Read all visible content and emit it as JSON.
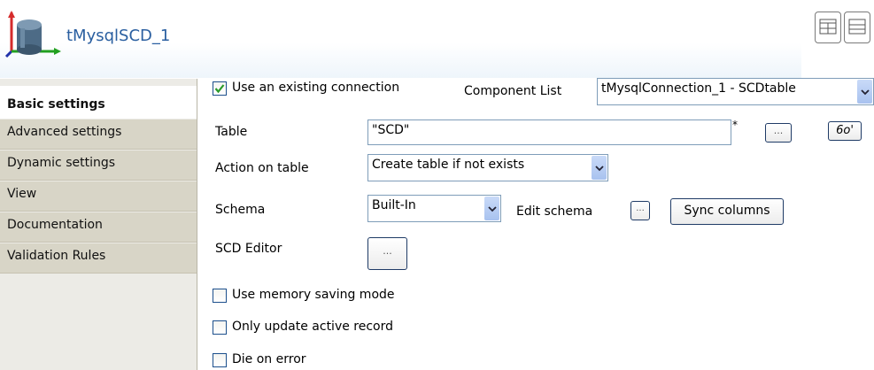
{
  "component": {
    "title": "tMysqlSCD_1",
    "icon": "database-cylinder-icon"
  },
  "header_buttons": [
    "grid-layout-icon",
    "list-layout-icon"
  ],
  "sidebar": {
    "items": [
      {
        "label": "Basic settings",
        "active": true
      },
      {
        "label": "Advanced settings",
        "active": false
      },
      {
        "label": "Dynamic settings",
        "active": false
      },
      {
        "label": "View",
        "active": false
      },
      {
        "label": "Documentation",
        "active": false
      },
      {
        "label": "Validation Rules",
        "active": false
      }
    ]
  },
  "form": {
    "use_existing": {
      "label": "Use an existing connection",
      "checked": true
    },
    "component_list": {
      "label": "Component List",
      "value": "tMysqlConnection_1 - SCDtable"
    },
    "table": {
      "label": "Table",
      "value": "\"SCD\"",
      "required_mark": "*",
      "browse": "...",
      "view_icon": "glasses-icon",
      "view_text": "6o'"
    },
    "action_on_table": {
      "label": "Action on table",
      "value": "Create table if not exists"
    },
    "schema": {
      "label": "Schema",
      "value": "Built-In",
      "edit_label": "Edit schema",
      "edit_button": "...",
      "sync_button": "Sync columns"
    },
    "scd_editor": {
      "label": "SCD Editor",
      "button": "..."
    },
    "memory_saving": {
      "label": "Use memory saving mode",
      "checked": false
    },
    "update_active": {
      "label": "Only update active record",
      "checked": false
    },
    "die_on_error": {
      "label": "Die on error",
      "checked": false
    }
  },
  "colors": {
    "title": "#2a5fa0",
    "sidebar_bg": "#d8d5c7",
    "border_blue": "#7f9db9",
    "checkmark": "#2a9a2a"
  }
}
